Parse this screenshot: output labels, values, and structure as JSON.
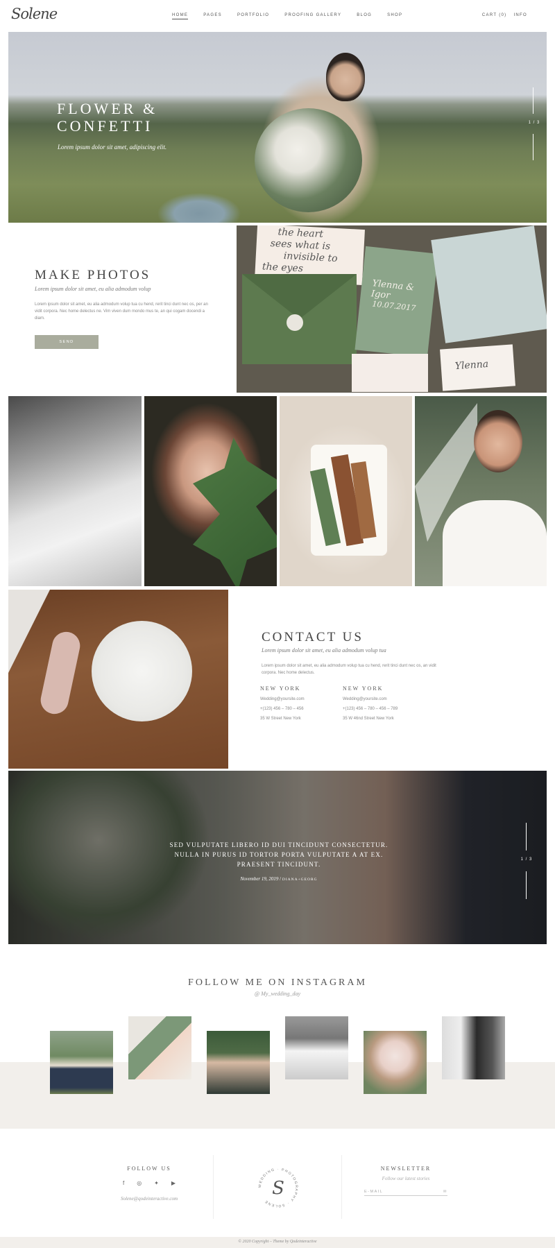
{
  "header": {
    "logo": "Solene",
    "nav": [
      "HOME",
      "PAGES",
      "PORTFOLIO",
      "PROOFING GALLERY",
      "BLOG",
      "SHOP"
    ],
    "cart": "CART (0)",
    "info": "INFO"
  },
  "hero": {
    "title_line1": "FLOWER &",
    "title_line2": "CONFETTI",
    "subtitle": "Lorem ipsum dolor sit amet, adipiscing elit.",
    "pager": "1 / 3"
  },
  "make_photos": {
    "title": "MAKE PHOTOS",
    "subtitle": "Lorem ipsum dolor sit amet, eu alia admodum volup",
    "body": "Lorem ipsum dolor sit amet, eu alia admodum volup tua cu hend, rerit tinci dunt nec os, per an vidit corpora. Nec home delectus ne. Vim viven dum mondo mus te, an qui cogam docendi a diam.",
    "button": "SEND"
  },
  "stationery_script": {
    "line1": "the heart",
    "line2": "sees what is",
    "line3": "invisible to",
    "line4": "the eyes",
    "names": "Ylenna & Igor",
    "date": "10.07.2017",
    "small": "Ylenna"
  },
  "contact": {
    "title": "CONTACT US",
    "subtitle": "Lorem ipsum dolor sit amet, eu alia admodum volup tua",
    "body": "Lorem ipsum dolor sit amet, eu alia admodum volup tua cu hend, rerit tinci dunt nec os, an vidit corpora. Nec home delectus.",
    "offices": [
      {
        "city": "NEW YORK",
        "email": "Wedding@yoursite.com",
        "phone": "+(123) 456 – 780 – 456",
        "address": "35 W Street New York"
      },
      {
        "city": "NEW YORK",
        "email": "Wedding@yoursite.com",
        "phone": "+(123) 456 – 780 – 456 – 789",
        "address": "35 W 46nd Street New York"
      }
    ]
  },
  "quote": {
    "text": "SED VULPUTATE LIBERO ID DUI TINCIDUNT CONSECTETUR. NULLA IN PURUS ID TORTOR PORTA VULPUTATE A AT EX. PRAESENT TINCIDUNT.",
    "date": "November 19, 2019",
    "author": "DIANA+GEORG",
    "pager": "1 / 3"
  },
  "instagram": {
    "title": "FOLLOW ME ON INSTAGRAM",
    "handle": "@ My_wedding_day"
  },
  "footer": {
    "follow_title": "FOLLOW US",
    "email": "Solene@qodeinteractive.com",
    "seal_text": "WEDDING · PHOTOGRAPHY · SOLENE",
    "newsletter_title": "NEWSLETTER",
    "newsletter_sub": "Follow our latest stories",
    "newsletter_placeholder": "E-MAIL",
    "copyright": "© 2020 Copyright – Theme by Qodeinteractive"
  }
}
